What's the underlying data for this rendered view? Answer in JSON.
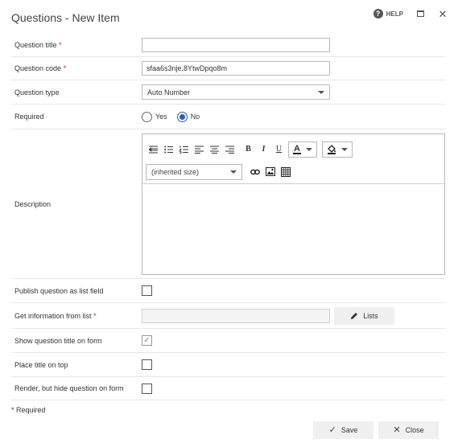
{
  "dialog": {
    "title": "Questions - New Item",
    "help_label": "HELP"
  },
  "fields": {
    "question_title": {
      "label": "Question title",
      "required_mark": "*",
      "value": ""
    },
    "question_code": {
      "label": "Question code",
      "required_mark": "*",
      "value": "sfaa6s3nje,8YtwDpqo8m"
    },
    "question_type": {
      "label": "Question type",
      "value": "Auto Number"
    },
    "required": {
      "label": "Required",
      "options": [
        "Yes",
        "No"
      ],
      "selected": "No"
    },
    "description": {
      "label": "Description",
      "font_size_select": "(inherited size)"
    },
    "publish_list_field": {
      "label": "Publish question as list field",
      "checked": false
    },
    "get_info_from_list": {
      "label": "Get information from list",
      "required_mark": "*",
      "button_label": "Lists"
    },
    "show_title_on_form": {
      "label": "Show question title on form",
      "checked": true
    },
    "place_title_on_top": {
      "label": "Place title on top",
      "checked": false
    },
    "render_hide": {
      "label": "Render, but hide question on form",
      "checked": false
    }
  },
  "footer": {
    "required_note": "* Required",
    "save_label": "Save",
    "close_label": "Close"
  },
  "icons": {
    "help": "question-circle-icon",
    "maximize": "maximize-icon",
    "close": "close-icon",
    "edit": "pencil-icon",
    "save": "check-icon"
  },
  "colors": {
    "required": "#cc2222",
    "radio_selected": "#2a5fb0"
  }
}
